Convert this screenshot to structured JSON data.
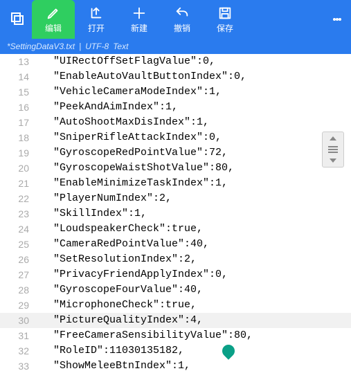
{
  "toolbar": {
    "edit": "编辑",
    "open": "打开",
    "new": "新建",
    "undo": "撤销",
    "save": "保存"
  },
  "tab": {
    "filename": "*SettingDataV3.txt",
    "encoding": "UTF-8",
    "type": "Text"
  },
  "gutter_start": 13,
  "highlight_line": 30,
  "caret": {
    "line": 31,
    "col": 32
  },
  "lines": [
    {
      "key": "UIRectOffSetFlagValue",
      "val": "0"
    },
    {
      "key": "EnableAutoVaultButtonIndex",
      "val": "0"
    },
    {
      "key": "VehicleCameraModeIndex",
      "val": "1"
    },
    {
      "key": "PeekAndAimIndex",
      "val": "1"
    },
    {
      "key": "AutoShootMaxDisIndex",
      "val": "1"
    },
    {
      "key": "SniperRifleAttackIndex",
      "val": "0"
    },
    {
      "key": "GyroscopeRedPointValue",
      "val": "72"
    },
    {
      "key": "GyroscopeWaistShotValue",
      "val": "80"
    },
    {
      "key": "EnableMinimizeTaskIndex",
      "val": "1"
    },
    {
      "key": "PlayerNumIndex",
      "val": "2"
    },
    {
      "key": "SkillIndex",
      "val": "1"
    },
    {
      "key": "LoudspeakerCheck",
      "val": "true"
    },
    {
      "key": "CameraRedPointValue",
      "val": "40"
    },
    {
      "key": "SetResolutionIndex",
      "val": "2"
    },
    {
      "key": "PrivacyFriendApplyIndex",
      "val": "0"
    },
    {
      "key": "GyroscopeFourValue",
      "val": "40"
    },
    {
      "key": "MicrophoneCheck",
      "val": "true"
    },
    {
      "key": "PictureQualityIndex",
      "val": "4"
    },
    {
      "key": "FreeCameraSensibilityValue",
      "val": "80"
    },
    {
      "key": "RoleID",
      "val": "11030135182"
    },
    {
      "key": "ShowMeleeBtnIndex",
      "val": "1"
    }
  ]
}
